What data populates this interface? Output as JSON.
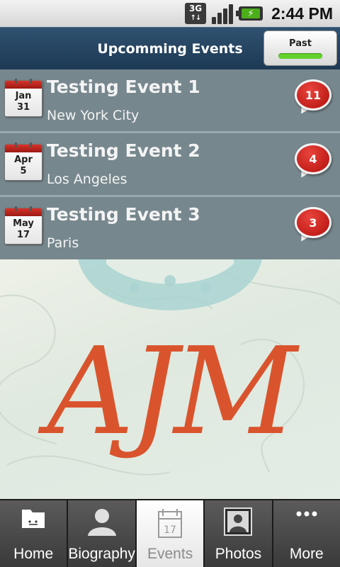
{
  "status_bar": {
    "network": "3G",
    "time": "2:44 PM"
  },
  "header": {
    "title": "Upcomming Events",
    "past_button_label": "Past"
  },
  "events": [
    {
      "month": "Jan",
      "day": "31",
      "title": "Testing Event 1",
      "location": "New York City",
      "count": "11"
    },
    {
      "month": "Apr",
      "day": "5",
      "title": "Testing Event 2",
      "location": "Los Angeles",
      "count": "4"
    },
    {
      "month": "May",
      "day": "17",
      "title": "Testing Event 3",
      "location": "Paris",
      "count": "3"
    }
  ],
  "banner": {
    "monogram": "AJM"
  },
  "tabs": [
    {
      "label": "Home",
      "icon": "home-folder-icon",
      "active": false
    },
    {
      "label": "Biography",
      "icon": "person-icon",
      "active": false
    },
    {
      "label": "Events",
      "icon": "calendar-icon",
      "active": true,
      "icon_text": "17"
    },
    {
      "label": "Photos",
      "icon": "photo-icon",
      "active": false
    },
    {
      "label": "More",
      "icon": "more-dots-icon",
      "active": false
    }
  ],
  "colors": {
    "header_bg": "#2f5170",
    "row_bg": "#76878d",
    "badge_red": "#c8201a",
    "past_indicator": "#63d22a",
    "monogram": "#d9542d"
  }
}
